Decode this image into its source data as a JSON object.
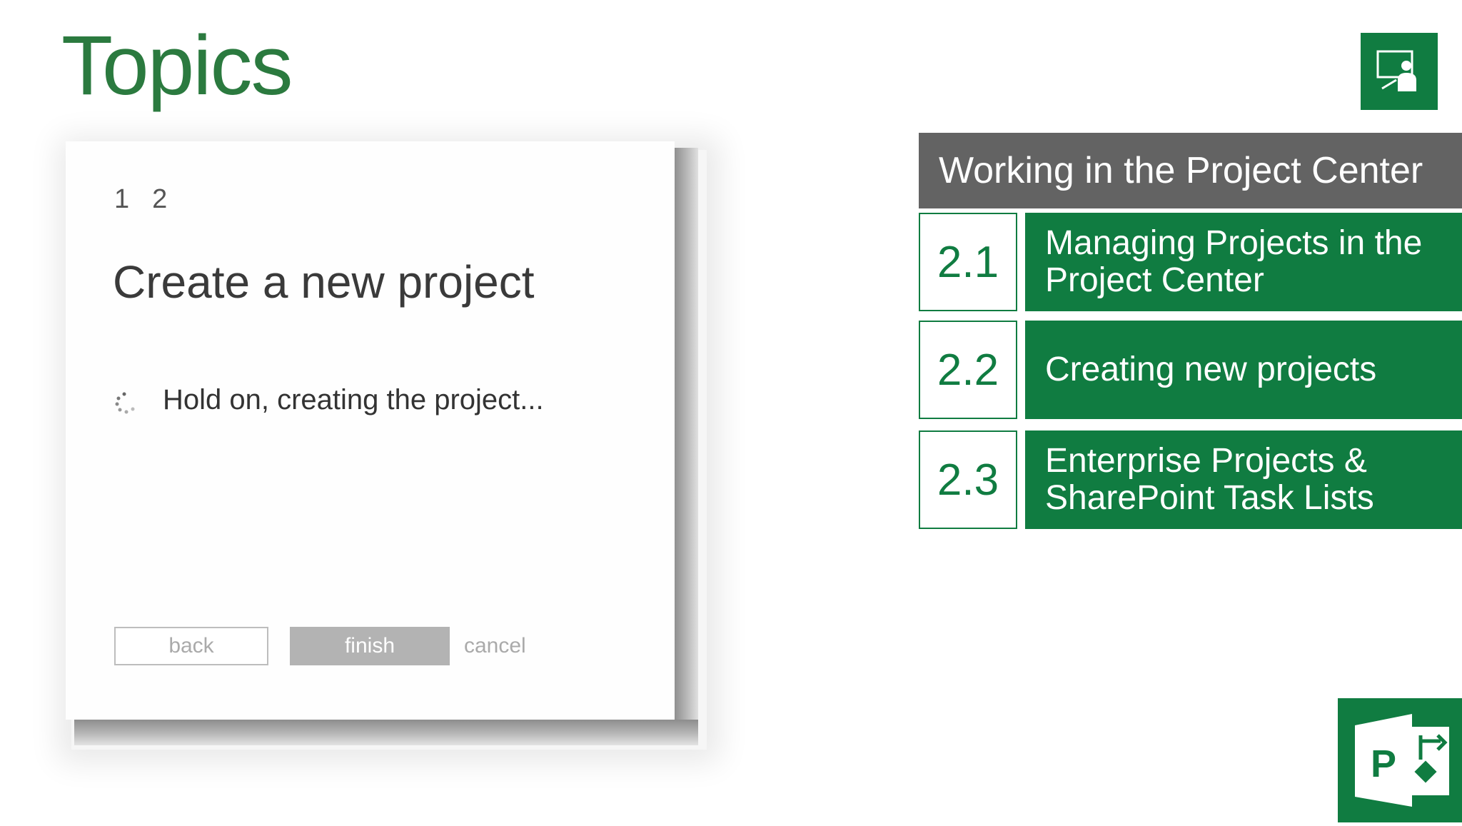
{
  "slide": {
    "title": "Topics",
    "brand_color": "#107c41"
  },
  "dialog": {
    "steps": [
      "1",
      "2"
    ],
    "heading": "Create a new project",
    "status_text": "Hold on, creating the project...",
    "buttons": {
      "back": "back",
      "finish": "finish",
      "cancel": "cancel"
    }
  },
  "agenda": {
    "header": "Working in the Project Center",
    "items": [
      {
        "number": "2.1",
        "label": "Managing Projects in the Project Center"
      },
      {
        "number": "2.2",
        "label": "Creating new projects"
      },
      {
        "number": "2.3",
        "label": "Enterprise Projects & SharePoint Task Lists"
      }
    ]
  },
  "icons": {
    "presenter": "presenter-icon",
    "app_logo": "project-logo-icon",
    "spinner": "loading-spinner-icon"
  },
  "app_logo_letter": "P"
}
